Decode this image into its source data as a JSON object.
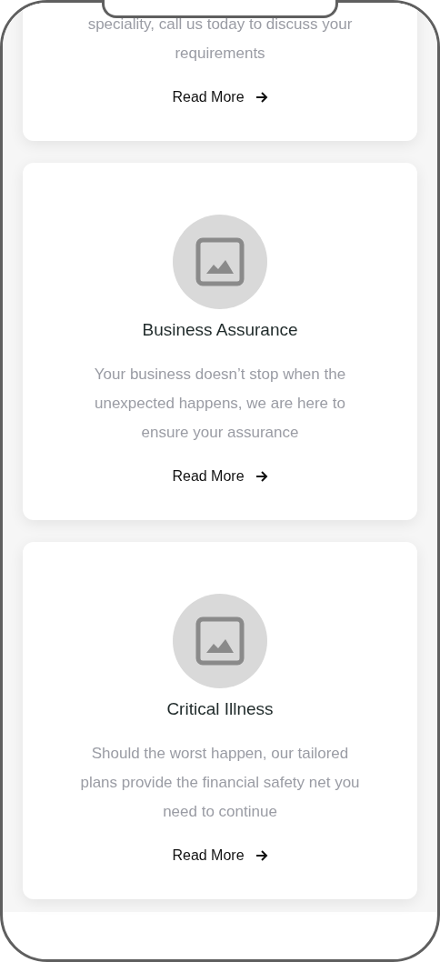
{
  "cards": [
    {
      "partial": true,
      "description": "speciality, call us today to discuss your requirements",
      "link": "Read More"
    },
    {
      "partial": false,
      "title": "Business Assurance",
      "description": "Your business doesn’t stop when the unexpected happens, we are here to ensure your assurance",
      "link": "Read More"
    },
    {
      "partial": false,
      "title": "Critical Illness",
      "description": "Should the worst happen, our tailored plans provide the financial safety net you need to continue",
      "link": "Read More"
    }
  ]
}
